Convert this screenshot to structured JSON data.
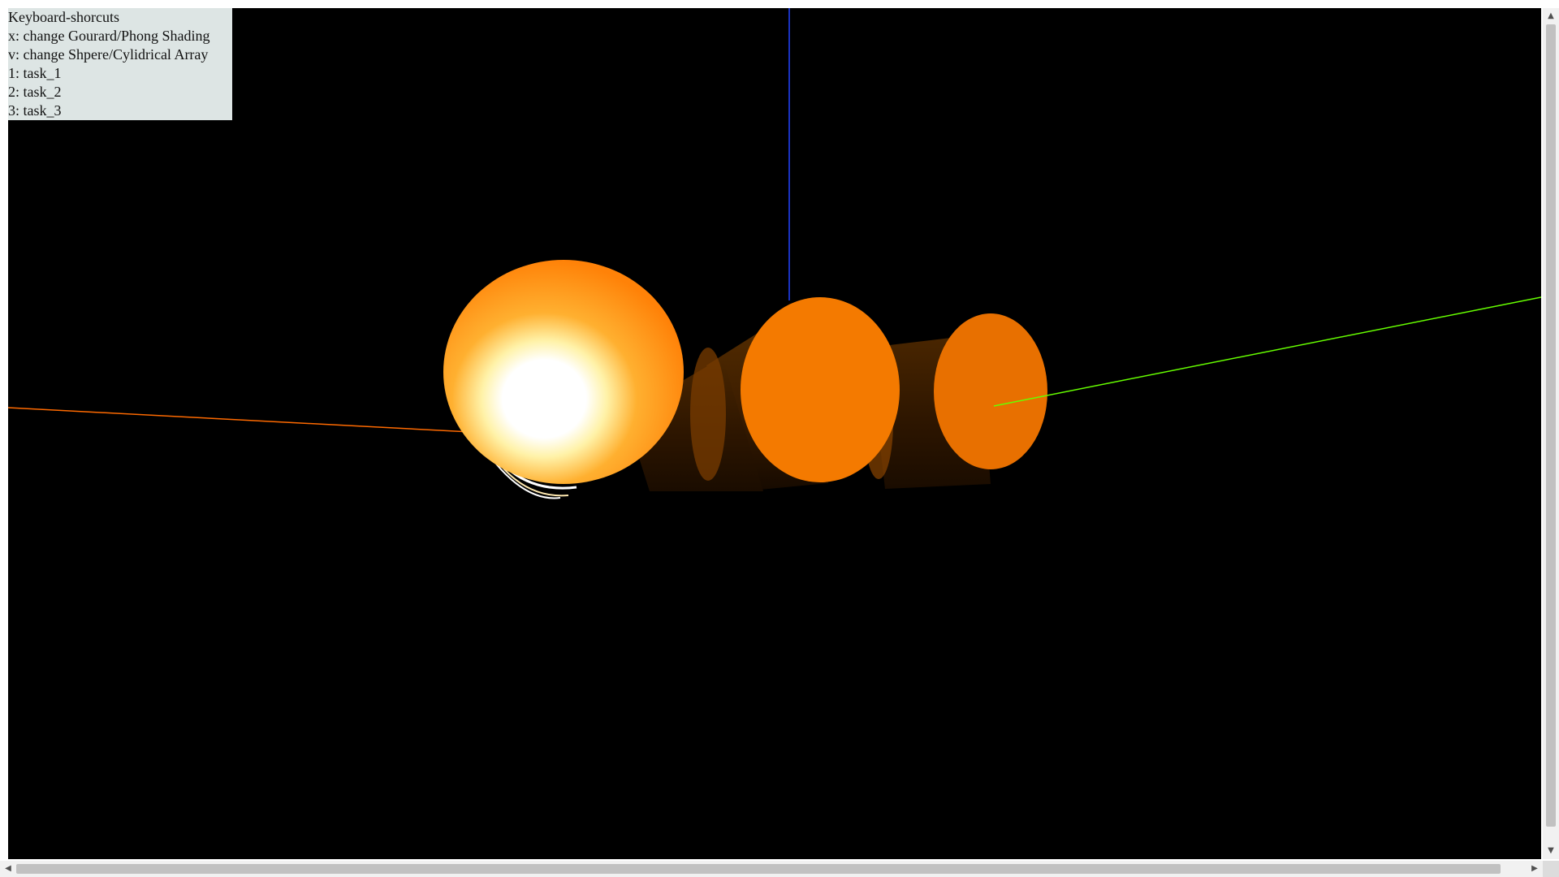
{
  "help_panel": {
    "lines": [
      "Keyboard-shorcuts",
      "x: change Gourard/Phong Shading",
      "v: change Shpere/Cylidrical Array",
      "1: task_1",
      "2: task_2",
      "3: task_3"
    ]
  },
  "scene": {
    "background": "#000000",
    "axis_colors": {
      "x": "#ff6a00",
      "y": "#66ff00",
      "z": "#2244ff"
    },
    "object_color": "#ff8a10",
    "highlight_color": "#ffffff"
  },
  "scrollbars": {
    "up_arrow": "▲",
    "down_arrow": "▼",
    "left_arrow": "◀",
    "right_arrow": "▶"
  }
}
